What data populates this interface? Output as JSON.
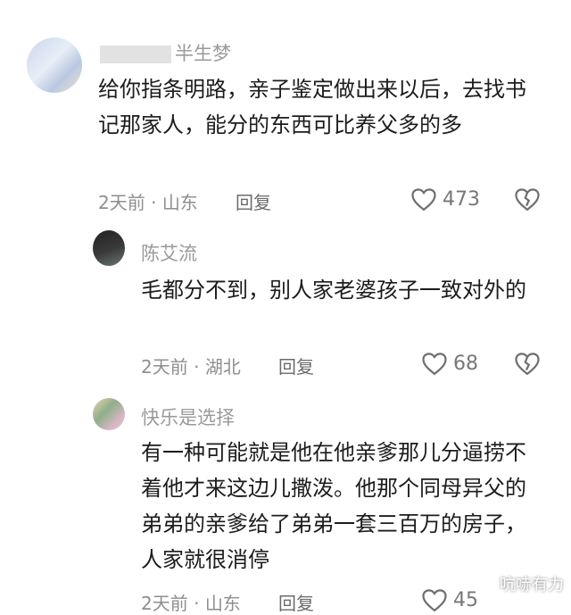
{
  "comments": [
    {
      "username": "半生梦",
      "text": "给你指条明路，亲子鉴定做出来以后，去找书记那家人，能分的东西可比养父多的多",
      "time": "2天前",
      "location": "山东",
      "reply_label": "回复",
      "likes": "473",
      "icons": {
        "like": "heart-outline-icon",
        "dislike": "broken-heart-icon"
      }
    },
    {
      "username": "陈艾流",
      "text": "毛都分不到，别人家老婆孩子一致对外的",
      "time": "2天前",
      "location": "湖北",
      "reply_label": "回复",
      "likes": "68",
      "icons": {
        "like": "heart-outline-icon",
        "dislike": "broken-heart-icon"
      }
    },
    {
      "username": "快乐是选择",
      "text": "有一种可能就是他在他亲爹那儿分逼捞不着他才来这边儿撒泼。他那个同母异父的弟弟的亲爹给了弟弟一套三百万的房子，人家就很消停",
      "time": "2天前",
      "location": "山东",
      "reply_label": "回复",
      "likes": "45",
      "icons": {
        "like": "heart-outline-icon",
        "dislike": "broken-heart-icon"
      }
    }
  ],
  "separator": " · ",
  "watermark": "吭哧有力"
}
